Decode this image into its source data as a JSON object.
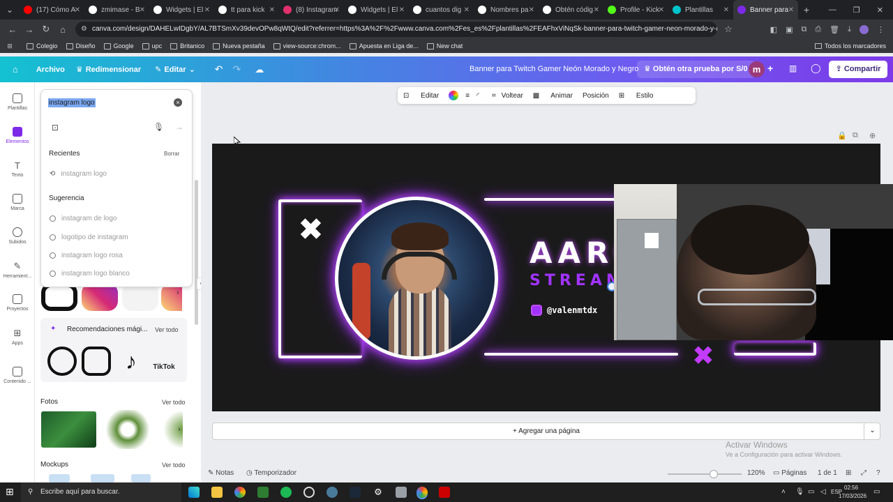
{
  "browser": {
    "tabs": [
      {
        "label": "(17) Cómo A",
        "color": "#ff0000"
      },
      {
        "label": "zmimase - B",
        "color": "#ffffff"
      },
      {
        "label": "Widgets | El",
        "color": "#ffffff"
      },
      {
        "label": "tt para kick",
        "color": "#ffffff"
      },
      {
        "label": "(8) Instagram",
        "color": "#e1306c"
      },
      {
        "label": "Widgets | El",
        "color": "#ffffff"
      },
      {
        "label": "cuantos dig",
        "color": "#ffffff"
      },
      {
        "label": "Nombres pa",
        "color": "#ffffff"
      },
      {
        "label": "Obtén códig",
        "color": "#ffffff"
      },
      {
        "label": "Profile - Kick",
        "color": "#53fc18"
      },
      {
        "label": "Plantillas",
        "color": "#00c4cc"
      },
      {
        "label": "Banner para",
        "color": "#7d2ae8"
      }
    ],
    "url": "canva.com/design/DAHELwIDgbY/AL7BTSmXv39devOPw8qWtQ/edit?referrer=https%3A%2F%2Fwww.canva.com%2Fes_es%2Fplantillas%2FEAFhxViNqSk-banner-para-twitch-gamer-neon-morado-y-negro%2F&ui=eyJEI...",
    "bookmarks": [
      "Colegio",
      "Diseño",
      "Google",
      "upc",
      "Britanico",
      "Nueva pestaña",
      "view-source:chrom...",
      "Apuesta en Liga de...",
      "New chat"
    ],
    "bookmarks_right": "Todos los marcadores"
  },
  "canva": {
    "menu": {
      "file": "Archivo",
      "resize": "Redimensionar",
      "edit": "Editar"
    },
    "design_title": "Banner para Twitch Gamer Neón Morado y Negro",
    "trial": "Obtén otra prueba por S/0",
    "avatar_letter": "m",
    "share": "Compartir"
  },
  "rail": [
    {
      "label": "Plantillas"
    },
    {
      "label": "Elementos"
    },
    {
      "label": "Texto"
    },
    {
      "label": "Marca"
    },
    {
      "label": "Subidos"
    },
    {
      "label": "Herramient..."
    },
    {
      "label": "Proyectos"
    },
    {
      "label": "Apps"
    },
    {
      "label": "Contenido ..."
    }
  ],
  "search": {
    "query": "instagram logo",
    "recent_header": "Recientes",
    "clear": "Borrar",
    "recent": [
      "instagram logo"
    ],
    "suggest_header": "Sugerencia",
    "suggestions": [
      "instagram de logo",
      "logotipo de instagram",
      "instagram logo rosa",
      "instagram logo blanco"
    ]
  },
  "panel": {
    "magic_header": "Recomendaciones mági...",
    "see_all": "Ver todo",
    "photos_header": "Fotos",
    "mockups_header": "Mockups",
    "tiktok_label": "TikTok"
  },
  "context_toolbar": [
    "Editar",
    "Voltear",
    "Animar",
    "Posición",
    "Estilo"
  ],
  "banner": {
    "name": "AARO",
    "subtitle": "STREAM",
    "handle": "@valenmtdx"
  },
  "add_page": "+ Agregar una página",
  "status": {
    "notes": "Notas",
    "timer": "Temporizador",
    "zoom": "120%",
    "pages": "Páginas",
    "page_count": "1 de 1"
  },
  "watermark": {
    "line1": "Activar Windows",
    "line2": "Ve a Configuración para activar Windows."
  },
  "taskbar": {
    "search": "Escribe aquí para buscar.",
    "lang": "ESP",
    "time": "02:56",
    "date": "17/03/2026"
  }
}
